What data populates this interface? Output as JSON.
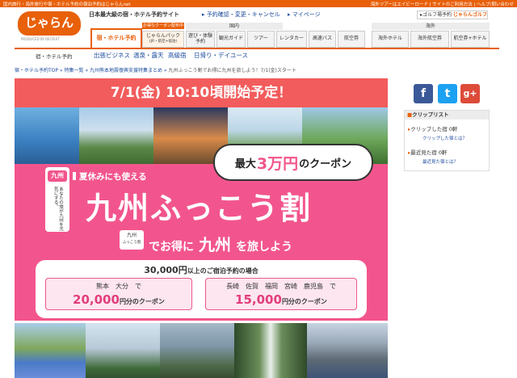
{
  "topbar": {
    "left": "国内旅行・海外旅行や宿・ホテル予約の宿泊予約はじゃらんnet",
    "right_links": [
      "海外ツアーはエイビーロード",
      "サイトのご利用方法",
      "ヘルプ/問い合わせ"
    ]
  },
  "logo": {
    "text": "じゃらん",
    "sub": "PRODUCED BY RECRUIT"
  },
  "header": {
    "tagline": "日本最大級の宿・ホテル予約サイト",
    "links": [
      "予約確認・変更・キャンセル",
      "マイページ"
    ],
    "golf_text": "ゴルフ場予約",
    "golf_brand": "じゃらんゴルフ"
  },
  "nav": {
    "active": "宿・ホテル予約",
    "badge": "お得なクーポン配布中",
    "domestic_label": "国内",
    "overseas_label": "海外",
    "items": [
      {
        "label": "じゃらんパック",
        "sub": "(JR・航空+宿泊)"
      },
      {
        "label": "遊び・体験予約"
      },
      {
        "label": "観光ガイド"
      },
      {
        "label": "ツアー"
      },
      {
        "label": "レンタカー"
      },
      {
        "label": "高速バス"
      },
      {
        "label": "航空券"
      }
    ],
    "overseas_items": [
      "海外ホテル",
      "海外航空券",
      "航空券+ホテル"
    ]
  },
  "subnav": {
    "left": "宿・ホテル予約",
    "links": [
      "出張ビジネス",
      "温泉・露天",
      "高級宿",
      "日帰り・デイユース"
    ]
  },
  "breadcrumb": {
    "items": [
      "宿・ホテル予約TOP",
      "特集一覧",
      "九州熊本地震復興支援特集まとめ"
    ],
    "current": "九州ふっこう割でお得に九州を旅しよう！7/1(金)スタート"
  },
  "banner": {
    "headline": "7/1(金) 10:10頃開始予定！",
    "max_coupon_prefix": "最大",
    "max_coupon_amount": "3万円",
    "max_coupon_suffix": "のクーポン",
    "ribbon": "夏休みにも使える",
    "title": "九州ふっこう割",
    "stamp_line1": "九州",
    "stamp_line2": "ふっこう割",
    "lead_prefix": "でお得に",
    "lead_region": "九州",
    "lead_suffix": "を旅しよう",
    "mascot_face": "九州",
    "mascot_text": "あなたの旅が九州を元気にする。",
    "condition_amount": "30,000円",
    "condition_rest": "以上のご宿泊予約の場合",
    "box1_places": "熊本　大分　で",
    "box1_amount": "20,000",
    "box2_places": "長崎　佐賀　福岡　宮崎　鹿児島　で",
    "box2_amount": "15,000",
    "amount_suffix": "円分のクーポン"
  },
  "social": {
    "facebook": "f",
    "twitter": "t",
    "google": "g+"
  },
  "clip": {
    "title": "クリップリスト",
    "row1_label": "クリップした宿",
    "row1_count": "0軒",
    "row1_link": "クリップした宿とは？",
    "row2_label": "最近見た宿",
    "row2_count": "0軒",
    "row2_link": "最近見た宿とは？"
  },
  "colors": {
    "brand": "#e8600a",
    "banner_red": "#f25c5c",
    "banner_pink": "#f2558d",
    "link": "#1a4a9c"
  }
}
